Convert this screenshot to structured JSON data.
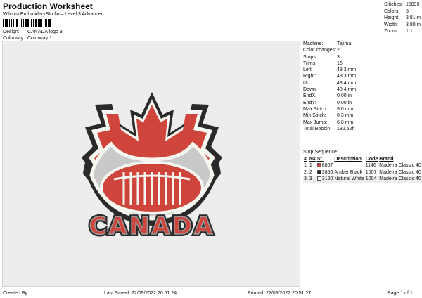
{
  "header": {
    "title": "Production Worksheet",
    "subtitle": "Wilcom EmbroideryStudio – Level 3 Advanced",
    "design_label": "Design:",
    "design_value": "CANADA logo 3",
    "colorway_label": "Colorway:",
    "colorway_value": "Colorway 1"
  },
  "stats": [
    {
      "label": "Stitches:",
      "value": "15839"
    },
    {
      "label": "Colors:",
      "value": "3"
    },
    {
      "label": "Height:",
      "value": "3.81 in"
    },
    {
      "label": "Width:",
      "value": "3.80 in"
    },
    {
      "label": "Zoom:",
      "value": "1:1"
    }
  ],
  "machine": [
    {
      "label": "Machine:",
      "value": "Tajima"
    },
    {
      "label": "Color changes:",
      "value": "2"
    },
    {
      "label": "Stops:",
      "value": "3"
    },
    {
      "label": "Trims:",
      "value": "16"
    },
    {
      "label": "Left:",
      "value": "48.3 mm"
    },
    {
      "label": "Right:",
      "value": "48.3 mm"
    },
    {
      "label": "Up:",
      "value": "48.4 mm"
    },
    {
      "label": "Down:",
      "value": "48.4 mm"
    },
    {
      "label": "EndX:",
      "value": "0.00 in"
    },
    {
      "label": "EndY:",
      "value": "0.00 in"
    },
    {
      "label": "Max Stitch:",
      "value": "9.0 mm"
    },
    {
      "label": "Min Stitch:",
      "value": "0.3 mm"
    },
    {
      "label": "Max Jump:",
      "value": "6.8 mm"
    },
    {
      "label": "Total Bobbin:",
      "value": "132.52ft"
    }
  ],
  "stop_sequence": {
    "label": "Stop Sequence:",
    "headers": [
      "#",
      "N#",
      "St.",
      "Description",
      "Code",
      "Brand"
    ],
    "rows": [
      {
        "num": "1.",
        "n": "1",
        "swatch": "#d0453b",
        "st": "8867",
        "description": "",
        "code": "1146",
        "brand": "Madeira Classic 40"
      },
      {
        "num": "2.",
        "n": "2",
        "swatch": "#2a2a2a",
        "st": "3850",
        "description": "Amber Black",
        "code": "1007",
        "brand": "Madeira Classic 40"
      },
      {
        "num": "3.",
        "n": "3",
        "swatch": "#f7f7f2",
        "st": "3120",
        "description": "Natural White",
        "code": "1004",
        "brand": "Madeira Classic 40"
      }
    ]
  },
  "design": {
    "text": "CANADA",
    "colors": {
      "red": "#d0453b",
      "black": "#2a2a2a",
      "white": "#f7f7f2"
    }
  },
  "footer": {
    "created_by": "Created By:",
    "last_saved": "Last Saved: 22/09/2022 20:51:24",
    "printed": "Printed: 22/09/2022 20:51:27",
    "page": "Page 1 of 1"
  }
}
